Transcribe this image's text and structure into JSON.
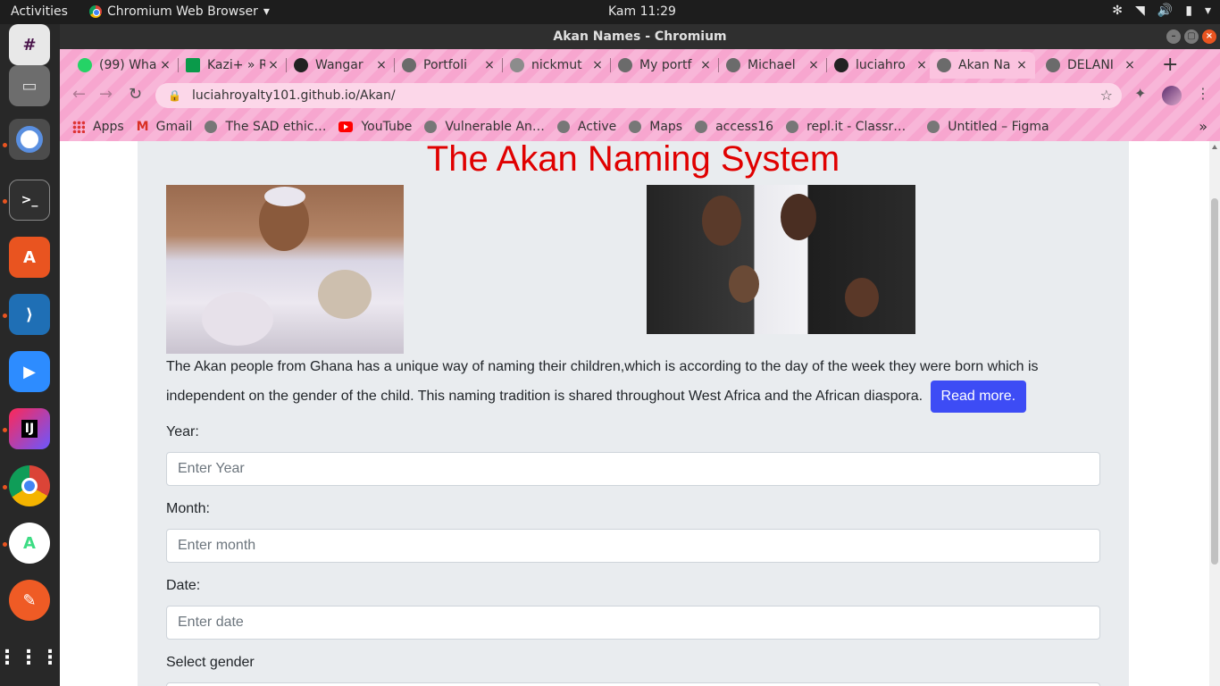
{
  "topbar": {
    "activities": "Activities",
    "app_name": "Chromium Web Browser",
    "clock": "Kam 11:29"
  },
  "window": {
    "title": "Akan Names - Chromium"
  },
  "tabs": [
    {
      "label": "(99) Wha"
    },
    {
      "label": "Kazi+ » R"
    },
    {
      "label": "Wangar"
    },
    {
      "label": "Portfoli"
    },
    {
      "label": "nickmut"
    },
    {
      "label": "My portf"
    },
    {
      "label": "Michael"
    },
    {
      "label": "luciahro"
    },
    {
      "label": "Akan Na"
    },
    {
      "label": "DELANI"
    }
  ],
  "address": {
    "url": "luciahroyalty101.github.io/Akan/"
  },
  "bookmarks": [
    {
      "label": "Apps"
    },
    {
      "label": "Gmail"
    },
    {
      "label": "The SAD ethic…"
    },
    {
      "label": "YouTube"
    },
    {
      "label": "Vulnerable An…"
    },
    {
      "label": "Active"
    },
    {
      "label": "Maps"
    },
    {
      "label": "access16"
    },
    {
      "label": "repl.it - Classr…"
    },
    {
      "label": "Untitled – Figma"
    }
  ],
  "page": {
    "title": "The Akan Naming System",
    "intro": "The Akan people from Ghana has a unique way of naming their children,which is according to the day of the week they were born which is independent on the gender of the child. This naming tradition is shared throughout West Africa and the African diaspora.",
    "read_more": "Read more.",
    "year_label": "Year:",
    "year_placeholder": "Enter Year",
    "month_label": "Month:",
    "month_placeholder": "Enter month",
    "date_label": "Date:",
    "date_placeholder": "Enter date",
    "gender_label": "Select gender"
  },
  "colors": {
    "title_red": "#e00000",
    "button_blue": "#3d4cf5",
    "chrome_pink": "#f7a6cf"
  }
}
